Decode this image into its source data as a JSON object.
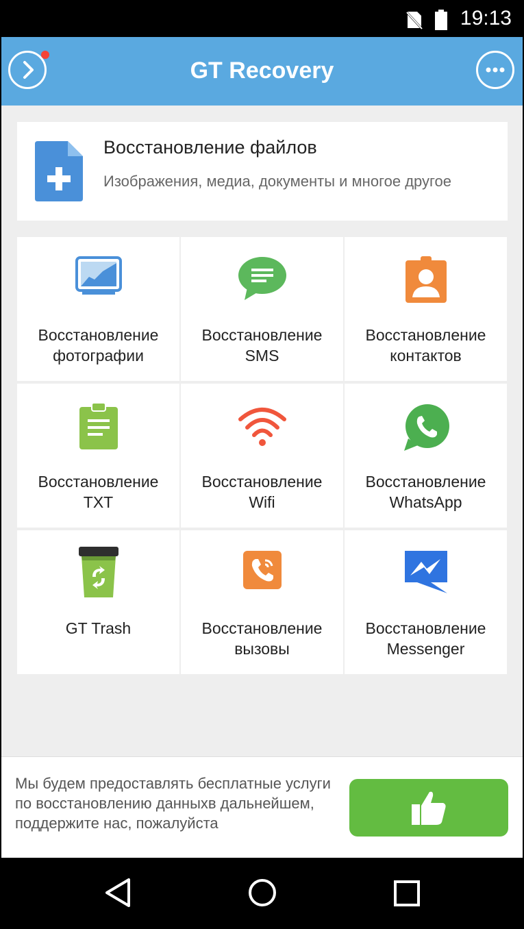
{
  "status": {
    "time": "19:13"
  },
  "header": {
    "title": "GT Recovery",
    "back_icon": "chevron-right-circle-icon",
    "menu_icon": "more-horizontal-icon",
    "accent": "#5aa9e0"
  },
  "file_recovery": {
    "title": "Восстановление файлов",
    "subtitle": "Изображения, медиа, документы и многое другое"
  },
  "tiles": [
    {
      "line1": "Восстановление",
      "line2": "фотографии",
      "icon": "photo-icon"
    },
    {
      "line1": "Восстановление",
      "line2": "SMS",
      "icon": "sms-icon"
    },
    {
      "line1": "Восстановление",
      "line2": "контактов",
      "icon": "contact-icon"
    },
    {
      "line1": "Восстановление",
      "line2": "TXT",
      "icon": "txt-icon"
    },
    {
      "line1": "Восстановление",
      "line2": "Wifi",
      "icon": "wifi-icon"
    },
    {
      "line1": "Восстановление",
      "line2": "WhatsApp",
      "icon": "whatsapp-icon"
    },
    {
      "line1": "GT Trash",
      "line2": "",
      "icon": "trash-icon"
    },
    {
      "line1": "Восстановление",
      "line2": "вызовы",
      "icon": "call-icon"
    },
    {
      "line1": "Восстановление",
      "line2": "Messenger",
      "icon": "messenger-icon"
    }
  ],
  "footer": {
    "text": "Мы будем предоставлять бесплатные услуги по восстановлению данныхв дальнейшем, поддержите нас, пожалуйста",
    "like_icon": "thumbs-up-icon",
    "button_color": "#63bc41"
  }
}
